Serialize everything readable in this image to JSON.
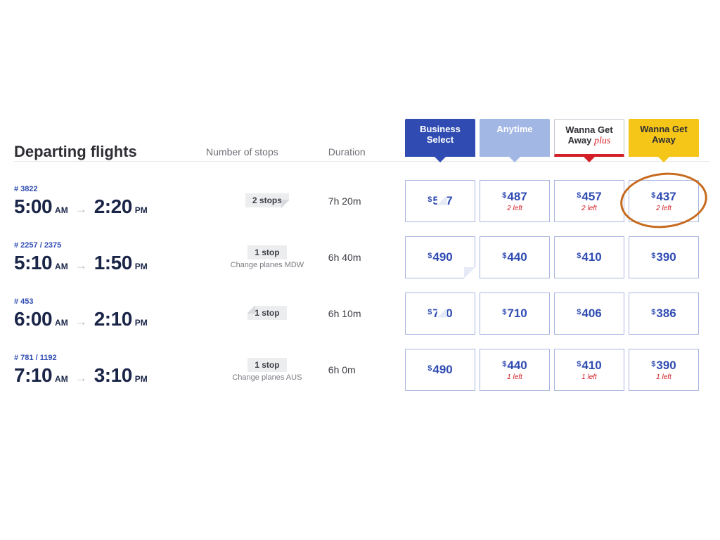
{
  "header": {
    "title": "Departing flights",
    "stops_label": "Number of stops",
    "duration_label": "Duration"
  },
  "fare_classes": [
    {
      "line1": "Business",
      "line2": "Select",
      "plus": ""
    },
    {
      "line1": "Anytime",
      "line2": "",
      "plus": ""
    },
    {
      "line1": "Wanna Get",
      "line2": "Away",
      "plus": "plus"
    },
    {
      "line1": "Wanna Get",
      "line2": "Away",
      "plus": ""
    }
  ],
  "flights": [
    {
      "num": "# 3822",
      "dep_t": "5:00",
      "dep_m": "AM",
      "arr_t": "2:20",
      "arr_m": "PM",
      "stops_badge": "2 stops",
      "stops_sub": "",
      "badge_curl": "br",
      "duration": "7h 20m",
      "fares": [
        {
          "price": "537",
          "left": "",
          "curl": "c2"
        },
        {
          "price": "487",
          "left": "2 left",
          "curl": ""
        },
        {
          "price": "457",
          "left": "2 left",
          "curl": ""
        },
        {
          "price": "437",
          "left": "2 left",
          "curl": "",
          "circled": true
        }
      ]
    },
    {
      "num": "# 2257 / 2375",
      "dep_t": "5:10",
      "dep_m": "AM",
      "arr_t": "1:50",
      "arr_m": "PM",
      "stops_badge": "1 stop",
      "stops_sub": "Change planes MDW",
      "badge_curl": "",
      "duration": "6h 40m",
      "fares": [
        {
          "price": "490",
          "left": "",
          "curl": "c"
        },
        {
          "price": "440",
          "left": "",
          "curl": ""
        },
        {
          "price": "410",
          "left": "",
          "curl": ""
        },
        {
          "price": "390",
          "left": "",
          "curl": ""
        }
      ]
    },
    {
      "num": "# 453",
      "dep_t": "6:00",
      "dep_m": "AM",
      "arr_t": "2:10",
      "arr_m": "PM",
      "stops_badge": "1 stop",
      "stops_sub": "",
      "badge_curl": "tl",
      "duration": "6h 10m",
      "fares": [
        {
          "price": "760",
          "left": "",
          "curl": "c2"
        },
        {
          "price": "710",
          "left": "",
          "curl": ""
        },
        {
          "price": "406",
          "left": "",
          "curl": ""
        },
        {
          "price": "386",
          "left": "",
          "curl": ""
        }
      ]
    },
    {
      "num": "# 781 / 1192",
      "dep_t": "7:10",
      "dep_m": "AM",
      "arr_t": "3:10",
      "arr_m": "PM",
      "stops_badge": "1 stop",
      "stops_sub": "Change planes AUS",
      "badge_curl": "",
      "duration": "6h 0m",
      "fares": [
        {
          "price": "490",
          "left": "",
          "curl": ""
        },
        {
          "price": "440",
          "left": "1 left",
          "curl": ""
        },
        {
          "price": "410",
          "left": "1 left",
          "curl": ""
        },
        {
          "price": "390",
          "left": "1 left",
          "curl": ""
        }
      ]
    }
  ]
}
